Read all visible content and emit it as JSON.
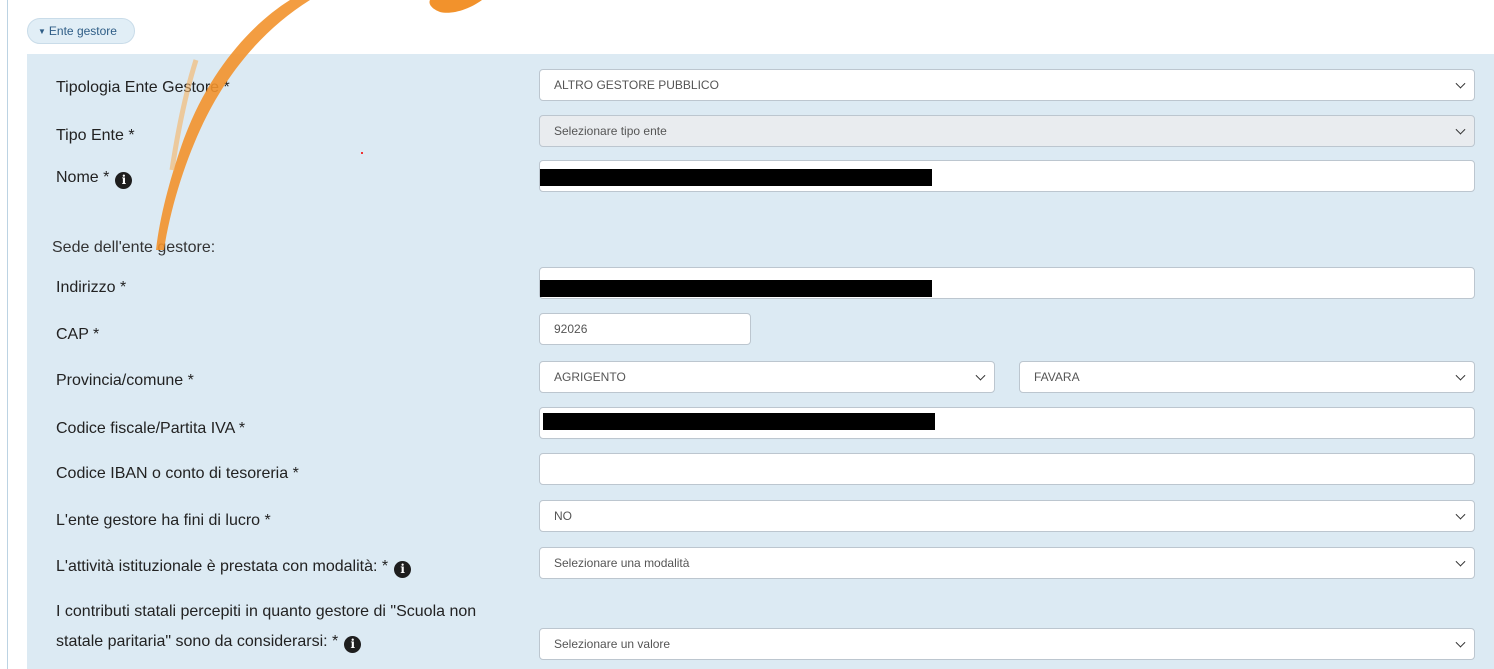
{
  "section": {
    "toggle_label": "Ente gestore",
    "caret_icon": "caret-down-icon"
  },
  "form": {
    "tipologia": {
      "label": "Tipologia Ente Gestore *",
      "value": "ALTRO GESTORE PUBBLICO"
    },
    "tipo_ente": {
      "label": "Tipo Ente *",
      "placeholder": "Selezionare tipo ente"
    },
    "nome": {
      "label": "Nome *",
      "value": ""
    },
    "sede_heading": "Sede dell'ente gestore:",
    "indirizzo": {
      "label": "Indirizzo *",
      "value": ""
    },
    "cap": {
      "label": "CAP *",
      "value": "92026"
    },
    "provincia_comune": {
      "label": "Provincia/comune *",
      "provincia": "AGRIGENTO",
      "comune": "FAVARA"
    },
    "codice_fiscale": {
      "label": "Codice fiscale/Partita IVA *",
      "value": ""
    },
    "iban": {
      "label": "Codice IBAN o conto di tesoreria *",
      "value": ""
    },
    "fini_lucro": {
      "label": "L'ente gestore ha fini di lucro *",
      "value": "NO"
    },
    "modalita": {
      "label": "L'attività istituzionale è prestata con modalità: *",
      "placeholder": "Selezionare una modalità"
    },
    "contributi": {
      "label_line1": "I contributi statali percepiti in quanto gestore di \"Scuola non",
      "label_line2": "statale paritaria\" sono da considerarsi: *",
      "placeholder": "Selezionare un valore"
    }
  },
  "colors": {
    "panel": "#dceaf3",
    "swoosh": "#f2922c",
    "pill": "#e1eef6"
  }
}
